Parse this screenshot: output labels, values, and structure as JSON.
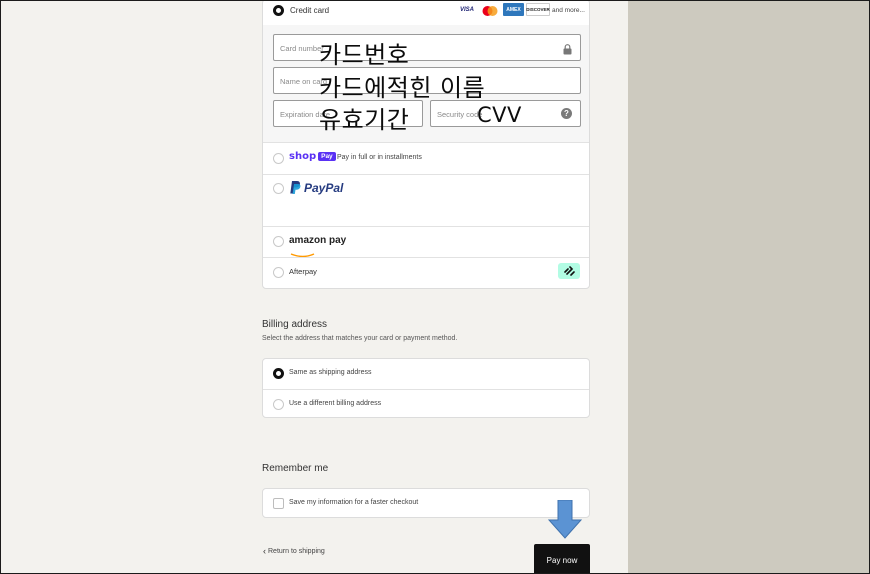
{
  "payment": {
    "credit_card_label": "Credit card",
    "card_brands": [
      "VISA",
      "AMEX",
      "DISCOVER"
    ],
    "and_more": "and more...",
    "card_number_placeholder": "Card number",
    "name_placeholder": "Name on card",
    "expiration_placeholder": "Expiration date",
    "security_placeholder": "Security code",
    "shop_pay_logo_text": "shop",
    "shop_pay_badge": "Pay",
    "shop_pay_desc": "Pay in full or in installments",
    "paypal_logo": "PayPal",
    "amazon_pay_logo": "amazon pay",
    "afterpay_label": "Afterpay"
  },
  "annotations": {
    "card_number": "카드번호",
    "name_on_card": "카드에적힌 이름",
    "expiration": "유효기간",
    "cvv": "CVV"
  },
  "billing": {
    "title": "Billing address",
    "subtitle": "Select the address that matches your card or payment method.",
    "same_label": "Same as shipping address",
    "different_label": "Use a different billing address"
  },
  "remember": {
    "title": "Remember me",
    "save_label": "Save my information for a faster checkout"
  },
  "footer": {
    "return_label": "Return to shipping",
    "pay_now_label": "Pay now"
  },
  "colors": {
    "pay_button": "#111111",
    "arrow": "#5b93d3",
    "afterpay_badge": "#b2fce4",
    "shop_pay": "#5a31f4",
    "paypal_dark": "#253b80",
    "paypal_light": "#179bd7",
    "background": "#f3f2ee",
    "right_panel": "#cdcabf"
  }
}
